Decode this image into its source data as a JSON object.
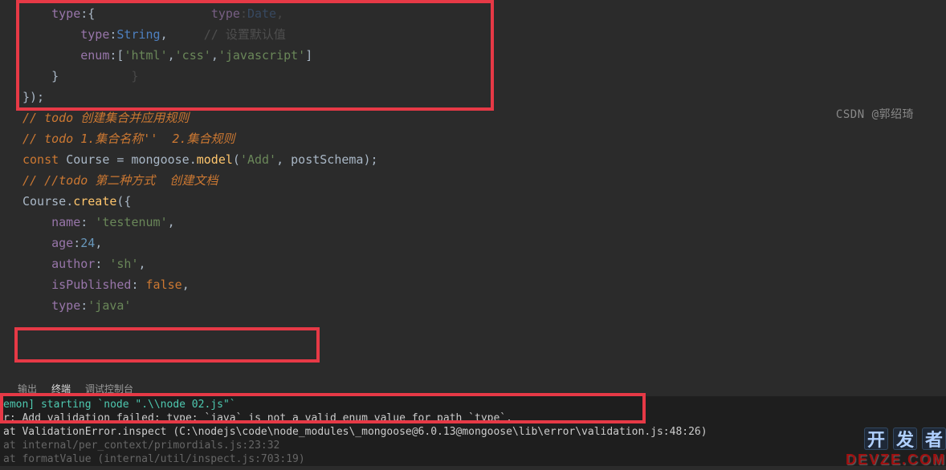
{
  "watermark": "CSDN @郭绍琦",
  "code": {
    "l1_prop": "type",
    "l1_ghost_prop": "type",
    "l1_ghost_type": "Date",
    "l2_prop": "type",
    "l2_type": "String",
    "l2_ghost": "// 设置默认值",
    "l3_prop": "enum",
    "l3_v1": "'html'",
    "l3_v2": "'css'",
    "l3_v3": "'javascript'",
    "l4_brace": "}",
    "l5_close": "});",
    "l6": "// todo 创建集合并应用规则",
    "l7": "// todo 1.集合名称''  2.集合规则",
    "l8_const": "const",
    "l8_var": "Course",
    "l8_eq": " = ",
    "l8_obj": "mongoose",
    "l8_method": "model",
    "l8_arg1": "'Add'",
    "l8_arg2": "postSchema",
    "l9_spacer": "",
    "l10": "// //todo 第二种方式  创建文档",
    "l11_obj": "Course",
    "l11_method": "create",
    "l12_prop": "name",
    "l12_val": "'testenum'",
    "l13_prop": "age",
    "l13_val": "24",
    "l14_prop": "author",
    "l14_val": "'sh'",
    "l15_prop": "isPublished",
    "l15_val": "false",
    "l16_prop": "type",
    "l16_val": "'java'"
  },
  "tabs": {
    "output": "输出",
    "terminal": "终端",
    "debug": "调试控制台"
  },
  "terminal": {
    "l1_a": "emon] st",
    "l1_b": "arting `node \".\\\\node 02.js\"`",
    "l2": "r: Add validation failed: type: `java` is not a valid enum value for path `type`.",
    "l3": "at ValidationError.inspect (C:\\nodejs\\code\\node_modules\\_mongoose@6.0.13@mongoose\\lib\\error\\validation.js:48:26)",
    "l4": "at internal/per_context/primordials.js:23:32",
    "l5": "at formatValue (internal/util/inspect.js:703:19)"
  },
  "logo": {
    "c1": "开",
    "c2": "发",
    "c3": "者",
    "url": "DEVZE.COM"
  }
}
